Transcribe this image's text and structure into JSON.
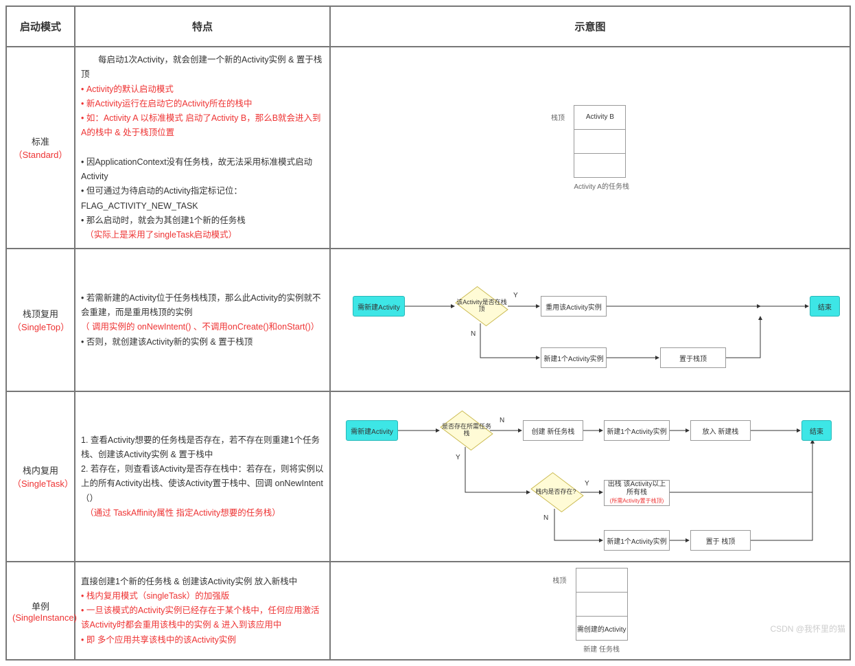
{
  "headers": {
    "mode": "启动模式",
    "features": "特点",
    "diagram": "示意图"
  },
  "rows": {
    "standard": {
      "name": "标准",
      "en": "（Standard）",
      "feat": {
        "l1": "　　每启动1次Activity，就会创建一个新的Activity实例 & 置于栈顶",
        "r1": "• Activity的默认启动模式",
        "r2": "• 新Activity运行在启动它的Activity所在的栈中",
        "r3": "• 如：Activity A 以标准模式 启动了Activity B，那么B就会进入到A的栈中 & 处于栈顶位置",
        "l2": "• 因ApplicationContext没有任务栈，故无法采用标准模式启动Activity",
        "l3": "• 但可通过为待启动的Activity指定标记位：FLAG_ACTIVITY_NEW_TASK",
        "l4": "• 那么启动时，就会为其创建1个新的任务栈",
        "r4": "　（实际上是采用了singleTask启动模式）"
      },
      "diag": {
        "top": "栈顶",
        "b": "Activity B",
        "cap": "Activity A的任务栈"
      }
    },
    "singletop": {
      "name": "栈顶复用",
      "en": "（SingleTop）",
      "feat": {
        "l1": "• 若需新建的Activity位于任务栈栈顶，那么此Activity的实例就不会重建，而是重用栈顶的实例",
        "r1": "（ 调用实例的 onNewIntent() 、不调用onCreate()和onStart()）",
        "l2": "• 否则，就创建该Activity新的实例 & 置于栈顶"
      },
      "diag": {
        "start": "需新建Activity",
        "d1": "该Activity是否在栈顶",
        "y": "Y",
        "n": "N",
        "reuse": "重用该Activity实例",
        "create": "新建1个Activity实例",
        "place": "置于栈顶",
        "end": "结束"
      }
    },
    "singletask": {
      "name": "栈内复用",
      "en": "（SingleTask）",
      "feat": {
        "l1": "1. 查看Activity想要的任务栈是否存在，若不存在则重建1个任务栈、创建该Activity实例 & 置于栈中",
        "l2": "2. 若存在，则查看该Activity是否存在栈中：若存在，则将实例以上的所有Activity出栈、使该Activity置于栈中、回调 onNewIntent（）",
        "r1": "　（通过 TaskAffinity属性 指定Activity想要的任务栈）"
      },
      "diag": {
        "start": "需新建Activity",
        "d1": "是否存在所需任务栈",
        "y": "Y",
        "n": "N",
        "newstack": "创建 新任务栈",
        "newinst": "新建1个Activity实例",
        "push": "放入 新建栈",
        "d2": "栈内是否存在?",
        "pop": "出栈 该Activity以上所有栈",
        "popnote": "(所需Activity置于栈顶)",
        "newinst2": "新建1个Activity实例",
        "place": "置于 栈顶",
        "end": "结束"
      }
    },
    "singleinstance": {
      "name": "单例",
      "en": "(SingleInstance)",
      "feat": {
        "l1": "直接创建1个新的任务栈 & 创建该Activity实例 放入新栈中",
        "r1": "• 栈内复用模式（singleTask）的加强版",
        "r2": "• 一旦该模式的Activity实例已经存在于某个栈中，任何应用激活该Activity时都会重用该栈中的实例 & 进入到该应用中",
        "r3": "• 即 多个应用共享该栈中的该Activity实例"
      },
      "diag": {
        "top": "栈顶",
        "b": "需创建的Activity",
        "cap": "新建 任务栈"
      }
    }
  },
  "watermark": "CSDN @我怀里的猫"
}
